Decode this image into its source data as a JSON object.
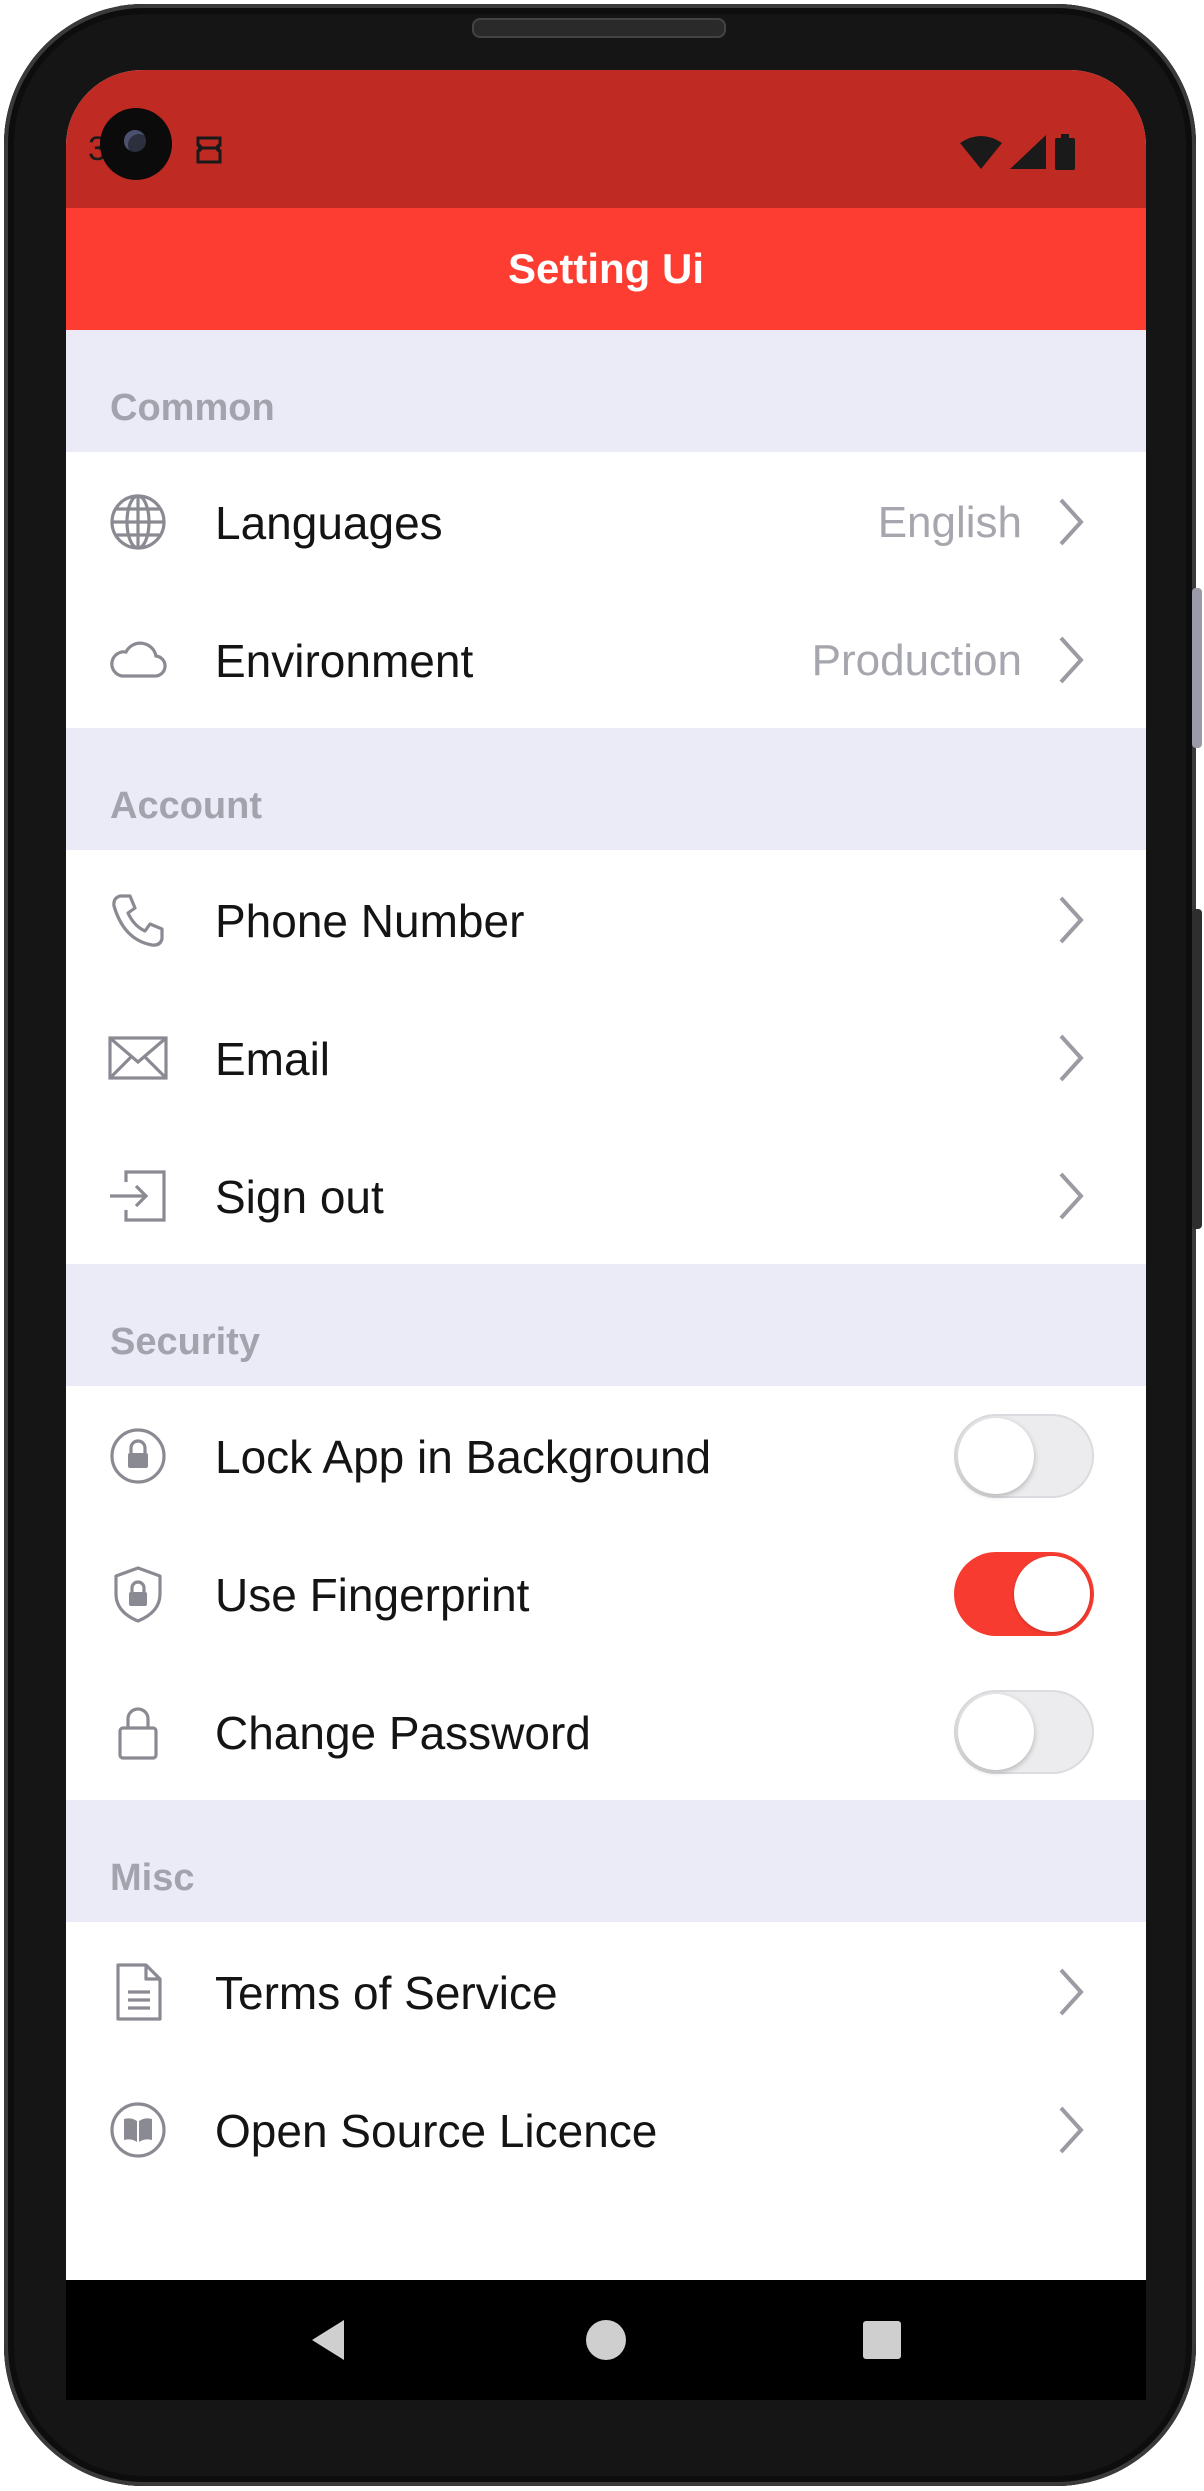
{
  "status_bar": {
    "time": "3",
    "notification_icon": "ticket-icon"
  },
  "app_bar": {
    "title": "Setting Ui"
  },
  "sections": {
    "common": {
      "title": "Common",
      "languages": {
        "label": "Languages",
        "value": "English",
        "icon": "globe-icon"
      },
      "environment": {
        "label": "Environment",
        "value": "Production",
        "icon": "cloud-icon"
      }
    },
    "account": {
      "title": "Account",
      "phone": {
        "label": "Phone Number",
        "icon": "phone-icon"
      },
      "email": {
        "label": "Email",
        "icon": "mail-icon"
      },
      "signout": {
        "label": "Sign out",
        "icon": "sign-out-icon"
      }
    },
    "security": {
      "title": "Security",
      "lock_app": {
        "label": "Lock App in Background",
        "enabled": false,
        "icon": "lock-circle-icon"
      },
      "fingerprint": {
        "label": "Use Fingerprint",
        "enabled": true,
        "icon": "shield-lock-icon"
      },
      "change_password": {
        "label": "Change Password",
        "enabled": false,
        "icon": "padlock-icon"
      }
    },
    "misc": {
      "title": "Misc",
      "terms": {
        "label": "Terms of Service",
        "icon": "document-icon"
      },
      "licence": {
        "label": "Open Source Licence",
        "icon": "book-icon"
      }
    }
  },
  "colors": {
    "status_bar": "#bf2a22",
    "app_bar": "#fd3d31",
    "section_bg": "#ebebf8",
    "toggle_on": "#f73b30"
  }
}
